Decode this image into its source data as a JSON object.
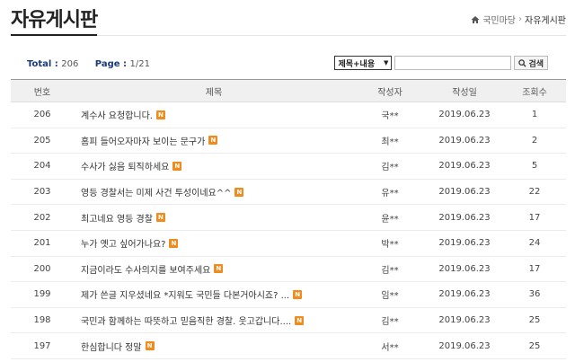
{
  "page": {
    "title": "자유게시판"
  },
  "breadcrumb": {
    "home": "국민마당",
    "separator": "›",
    "current": "자유게시판"
  },
  "summary": {
    "total_label": "Total",
    "total_value": "206",
    "page_label": "Page",
    "page_value": "1/21"
  },
  "search": {
    "select_value": "제목+내용",
    "select_arrow": "▼",
    "input_value": "",
    "button_label": "검색"
  },
  "table": {
    "headers": {
      "no": "번호",
      "title": "제목",
      "author": "작성자",
      "date": "작성일",
      "views": "조회수"
    },
    "new_badge": "N",
    "rows": [
      {
        "no": "206",
        "title": "계수사 요청합니다.",
        "author": "국**",
        "date": "2019.06.23",
        "views": "1"
      },
      {
        "no": "205",
        "title": "홈피 들어오자마자 보이는 문구가",
        "author": "최**",
        "date": "2019.06.23",
        "views": "2"
      },
      {
        "no": "204",
        "title": "수사가 싫음 퇴직하세요",
        "author": "김**",
        "date": "2019.06.23",
        "views": "5"
      },
      {
        "no": "203",
        "title": "영등 경찰서는 미제 사건 투성이네요^^",
        "author": "유**",
        "date": "2019.06.23",
        "views": "22"
      },
      {
        "no": "202",
        "title": "최고네요 영등 경찰",
        "author": "윤**",
        "date": "2019.06.23",
        "views": "17"
      },
      {
        "no": "201",
        "title": "누가 옛고 싶어가나요?",
        "author": "박**",
        "date": "2019.06.23",
        "views": "24"
      },
      {
        "no": "200",
        "title": "지금이라도 수사의지를 보여주세요",
        "author": "김**",
        "date": "2019.06.23",
        "views": "17"
      },
      {
        "no": "199",
        "title": "제가 쓴글 지우셨네요 *지워도 국민들 다본거아시죠? ...",
        "author": "임**",
        "date": "2019.06.23",
        "views": "36"
      },
      {
        "no": "198",
        "title": "국민과 함께하는 따뜻하고 믿음직한 경찰. 웃고갑니다....",
        "author": "김**",
        "date": "2019.06.23",
        "views": "25"
      },
      {
        "no": "197",
        "title": "한심합니다 정말",
        "author": "서**",
        "date": "2019.06.23",
        "views": "25"
      }
    ]
  }
}
